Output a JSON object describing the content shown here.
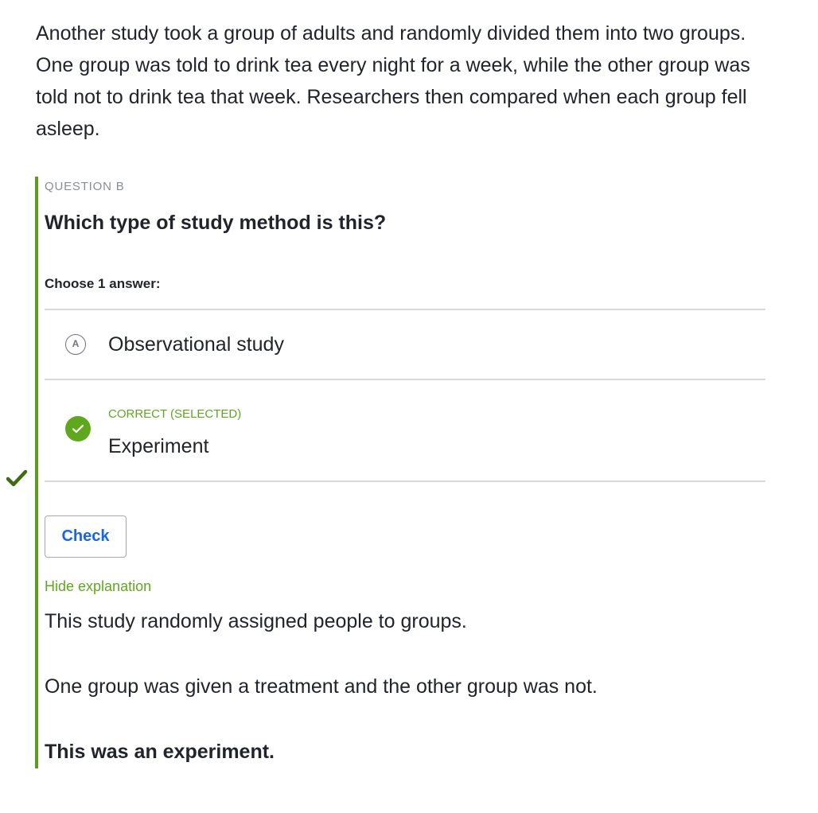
{
  "passage": "Another study took a group of adults and randomly divided them into two groups. One group was told to drink tea every night for a week, while the other group was told not to drink tea that week. Researchers then compared when each group fell asleep.",
  "question": {
    "label": "QUESTION B",
    "title": "Which type of study method is this?",
    "choose_label": "Choose 1 answer:",
    "choices": [
      {
        "letter": "A",
        "text": "Observational study",
        "selected": false
      },
      {
        "letter": "B",
        "text": "Experiment",
        "selected": true,
        "status": "CORRECT (SELECTED)"
      }
    ],
    "check_button": "Check",
    "hide_explanation": "Hide explanation",
    "explanation": [
      "This study randomly assigned people to groups.",
      "One group was given a treatment and the other group was not.",
      "This was an experiment."
    ]
  },
  "colors": {
    "correct_green": "#5fa81e",
    "accent_bar": "#5a9e1b",
    "side_check": "#3d6d10",
    "button_blue": "#1865f2",
    "divider": "#d6d8da",
    "text": "#21242c"
  },
  "icons": {
    "side_marker": "checkmark-icon",
    "correct_choice": "check-circle-icon"
  }
}
